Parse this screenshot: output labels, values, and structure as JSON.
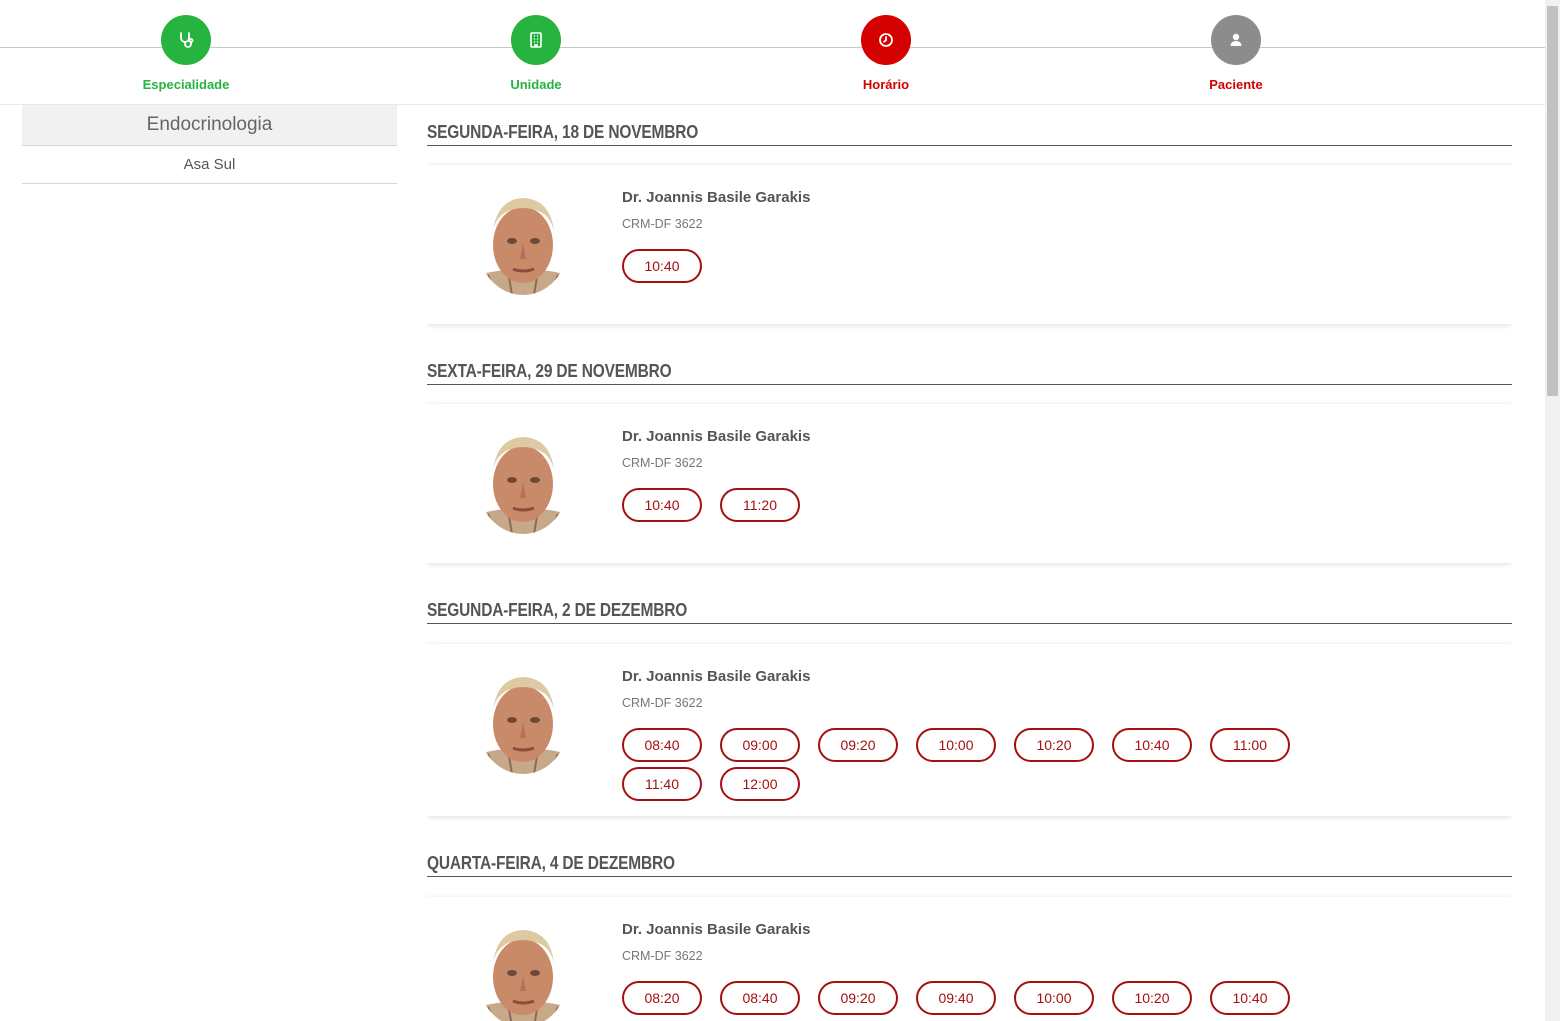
{
  "steps": [
    {
      "label": "Especialidade",
      "state": "done",
      "icon": "stethoscope-icon"
    },
    {
      "label": "Unidade",
      "state": "done",
      "icon": "building-icon"
    },
    {
      "label": "Horário",
      "state": "active",
      "icon": "clock-icon"
    },
    {
      "label": "Paciente",
      "state": "todo",
      "icon": "user-icon"
    }
  ],
  "sidebar": {
    "specialty": "Endocrinologia",
    "unit": "Asa Sul"
  },
  "days": [
    {
      "title": "SEGUNDA-FEIRA, 18 DE NOVEMBRO",
      "doctor": {
        "name": "Dr. Joannis Basile Garakis",
        "crm": "CRM-DF 3622"
      },
      "slots": [
        "10:40"
      ]
    },
    {
      "title": "SEXTA-FEIRA, 29 DE NOVEMBRO",
      "doctor": {
        "name": "Dr. Joannis Basile Garakis",
        "crm": "CRM-DF 3622"
      },
      "slots": [
        "10:40",
        "11:20"
      ]
    },
    {
      "title": "SEGUNDA-FEIRA, 2 DE DEZEMBRO",
      "doctor": {
        "name": "Dr. Joannis Basile Garakis",
        "crm": "CRM-DF 3622"
      },
      "slots": [
        "08:40",
        "09:00",
        "09:20",
        "10:00",
        "10:20",
        "10:40",
        "11:00",
        "11:40",
        "12:00"
      ]
    },
    {
      "title": "QUARTA-FEIRA, 4 DE DEZEMBRO",
      "doctor": {
        "name": "Dr. Joannis Basile Garakis",
        "crm": "CRM-DF 3622"
      },
      "slots": [
        "08:20",
        "08:40",
        "09:20",
        "09:40",
        "10:00",
        "10:20",
        "10:40"
      ]
    }
  ],
  "colors": {
    "done": "#27b33f",
    "active": "#d50000",
    "todo": "#8c8c8c",
    "slot": "#a50f0f"
  }
}
